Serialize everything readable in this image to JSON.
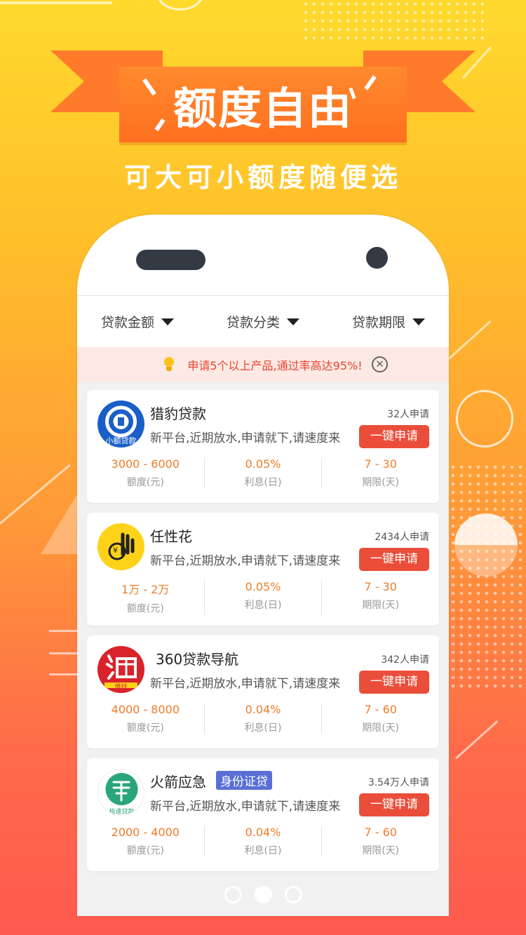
{
  "banner": {
    "title": "额度自由",
    "subtitle": "可大可小额度随便选"
  },
  "filters": [
    {
      "label": "贷款金额"
    },
    {
      "label": "贷款分类"
    },
    {
      "label": "贷款期限"
    }
  ],
  "notice": {
    "text": "申请5个以上产品,通过率高达95%!"
  },
  "products": [
    {
      "name": "猎豹贷款",
      "logo_text": "小额贷款",
      "applicants": "32人申请",
      "desc": "新平台,近期放水,申请就下,请速度来",
      "apply_label": "一键申请",
      "amount": "3000 - 6000",
      "amount_label": "额度(元)",
      "interest": "0.05%",
      "interest_label": "利息(日)",
      "term": "7 - 30",
      "term_label": "期限(天)"
    },
    {
      "name": "任性花",
      "logo_text": "¥",
      "applicants": "2434人申请",
      "desc": "新平台,近期放水,申请就下,请速度来",
      "apply_label": "一键申请",
      "amount": "1万 - 2万",
      "amount_label": "额度(元)",
      "interest": "0.05%",
      "interest_label": "利息(日)",
      "term": "7 - 30",
      "term_label": "期限(天)"
    },
    {
      "name": "360贷款导航",
      "logo_text": "借钱",
      "applicants": "342人申请",
      "desc": "新平台,近期放水,申请就下,请速度来",
      "apply_label": "一键申请",
      "amount": "4000 - 8000",
      "amount_label": "额度(元)",
      "interest": "0.04%",
      "interest_label": "利息(日)",
      "term": "7 - 60",
      "term_label": "期限(天)"
    },
    {
      "name": "火箭应急",
      "tag": "身份证贷",
      "logo_text": "极速贷款",
      "applicants": "3.54万人申请",
      "desc": "新平台,近期放水,申请就下,请速度来",
      "apply_label": "一键申请",
      "amount": "2000 - 4000",
      "amount_label": "额度(元)",
      "interest": "0.04%",
      "interest_label": "利息(日)",
      "term": "7 - 60",
      "term_label": "期限(天)"
    }
  ],
  "pager": {
    "count": 3,
    "active_index": 1
  }
}
